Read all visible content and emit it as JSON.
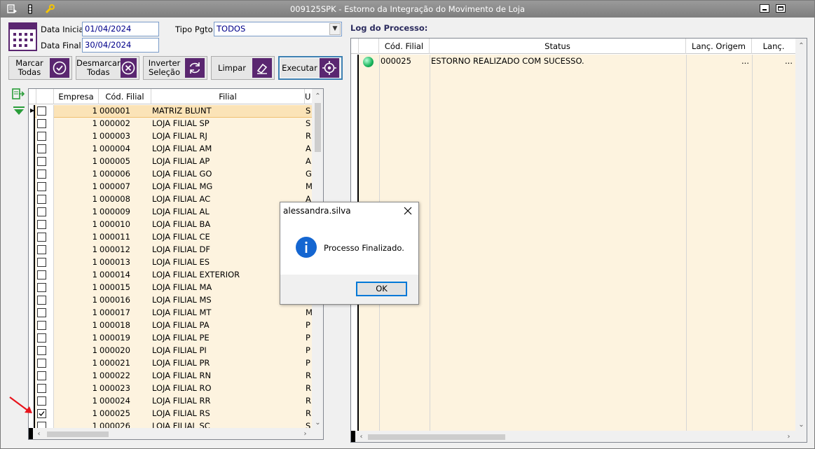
{
  "window": {
    "title": "009125SPK - Estorno da Integração do Movimento de Loja"
  },
  "filters": {
    "data_inicial_label": "Data Inicial:",
    "data_inicial_value": "01/04/2024",
    "data_final_label": "Data Final:",
    "data_final_value": "30/04/2024",
    "tipo_pgto_label": "Tipo Pgto:",
    "tipo_pgto_value": "TODOS"
  },
  "buttons": {
    "marcar_l1": "Marcar",
    "marcar_l2": "Todas",
    "desmarcar_l1": "Desmarcar",
    "desmarcar_l2": "Todas",
    "inverter_l1": "Inverter",
    "inverter_l2": "Seleção",
    "limpar": "Limpar",
    "executar": "Executar"
  },
  "left_grid": {
    "headers": {
      "empresa": "Empresa",
      "cod_filial": "Cód. Filial",
      "filial": "Filial",
      "extra": "U"
    },
    "rows": [
      {
        "empresa": "1",
        "cod": "000001",
        "filial": "MATRIZ BLUNT",
        "extra": "S",
        "checked": false
      },
      {
        "empresa": "1",
        "cod": "000002",
        "filial": "LOJA FILIAL SP",
        "extra": "S",
        "checked": false
      },
      {
        "empresa": "1",
        "cod": "000003",
        "filial": "LOJA FILIAL RJ",
        "extra": "R",
        "checked": false
      },
      {
        "empresa": "1",
        "cod": "000004",
        "filial": "LOJA FILIAL AM",
        "extra": "A",
        "checked": false
      },
      {
        "empresa": "1",
        "cod": "000005",
        "filial": "LOJA FILIAL AP",
        "extra": "A",
        "checked": false
      },
      {
        "empresa": "1",
        "cod": "000006",
        "filial": "LOJA FILIAL GO",
        "extra": "G",
        "checked": false
      },
      {
        "empresa": "1",
        "cod": "000007",
        "filial": "LOJA FILIAL MG",
        "extra": "M",
        "checked": false
      },
      {
        "empresa": "1",
        "cod": "000008",
        "filial": "LOJA FILIAL AC",
        "extra": "A",
        "checked": false
      },
      {
        "empresa": "1",
        "cod": "000009",
        "filial": "LOJA FILIAL AL",
        "extra": "A",
        "checked": false
      },
      {
        "empresa": "1",
        "cod": "000010",
        "filial": "LOJA FILIAL BA",
        "extra": "",
        "checked": false
      },
      {
        "empresa": "1",
        "cod": "000011",
        "filial": "LOJA FILIAL CE",
        "extra": "",
        "checked": false
      },
      {
        "empresa": "1",
        "cod": "000012",
        "filial": "LOJA FILIAL DF",
        "extra": "",
        "checked": false
      },
      {
        "empresa": "1",
        "cod": "000013",
        "filial": "LOJA FILIAL ES",
        "extra": "",
        "checked": false
      },
      {
        "empresa": "1",
        "cod": "000014",
        "filial": "LOJA FILIAL EXTERIOR",
        "extra": "",
        "checked": false
      },
      {
        "empresa": "1",
        "cod": "000015",
        "filial": "LOJA FILIAL MA",
        "extra": "",
        "checked": false
      },
      {
        "empresa": "1",
        "cod": "000016",
        "filial": "LOJA FILIAL MS",
        "extra": "",
        "checked": false
      },
      {
        "empresa": "1",
        "cod": "000017",
        "filial": "LOJA FILIAL MT",
        "extra": "M",
        "checked": false
      },
      {
        "empresa": "1",
        "cod": "000018",
        "filial": "LOJA FILIAL PA",
        "extra": "P",
        "checked": false
      },
      {
        "empresa": "1",
        "cod": "000019",
        "filial": "LOJA FILIAL PE",
        "extra": "P",
        "checked": false
      },
      {
        "empresa": "1",
        "cod": "000020",
        "filial": "LOJA FILIAL PI",
        "extra": "P",
        "checked": false
      },
      {
        "empresa": "1",
        "cod": "000021",
        "filial": "LOJA FILIAL PR",
        "extra": "P",
        "checked": false
      },
      {
        "empresa": "1",
        "cod": "000022",
        "filial": "LOJA FILIAL RN",
        "extra": "R",
        "checked": false
      },
      {
        "empresa": "1",
        "cod": "000023",
        "filial": "LOJA FILIAL RO",
        "extra": "R",
        "checked": false
      },
      {
        "empresa": "1",
        "cod": "000024",
        "filial": "LOJA FILIAL RR",
        "extra": "R",
        "checked": false
      },
      {
        "empresa": "1",
        "cod": "000025",
        "filial": "LOJA FILIAL RS",
        "extra": "R",
        "checked": true
      },
      {
        "empresa": "1",
        "cod": "000026",
        "filial": "LOJA FILIAL SC",
        "extra": "S",
        "checked": false
      }
    ]
  },
  "log": {
    "title": "Log do Processo:",
    "headers": {
      "cod_filial": "Cód. Filial",
      "status": "Status",
      "lanc_origem": "Lanç. Origem",
      "lanc_baixa": "Lanç. Baixa"
    },
    "rows": [
      {
        "cod": "000025",
        "status": "ESTORNO REALIZADO COM SUCESSO.",
        "origem": "...",
        "baixa": "..."
      }
    ]
  },
  "dialog": {
    "title": "alessandra.silva",
    "message": "Processo Finalizado.",
    "ok": "OK"
  },
  "colors": {
    "accent": "#5a2670",
    "row_bg": "#fdf3df",
    "selected_row": "#fbe3b7"
  }
}
